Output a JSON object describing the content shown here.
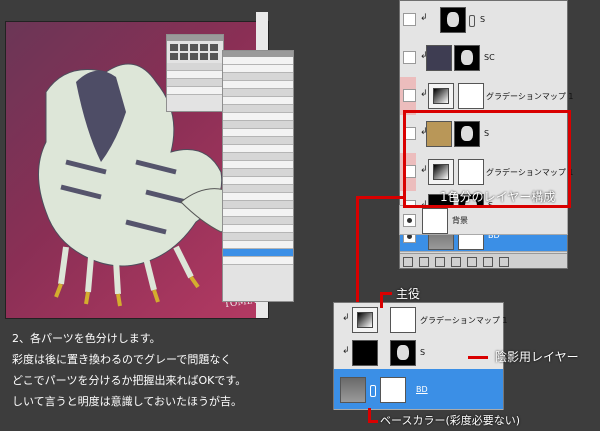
{
  "artist_signature": "TOMIA",
  "main_panel": {
    "layers": [
      {
        "label": "S",
        "thumb": "figure",
        "clipped": true,
        "highlight": false
      },
      {
        "label": "SC",
        "thumb": "navy",
        "clipped": true,
        "highlight": false
      },
      {
        "label": "グラデーションマップ 1",
        "thumb": "adj",
        "clipped": true,
        "highlight": true
      },
      {
        "label": "S",
        "thumb": "figure",
        "clipped": true,
        "highlight": false
      },
      {
        "label": "グラデーションマップ 1",
        "thumb": "adj",
        "clipped": true,
        "highlight": true
      },
      {
        "label": "S",
        "thumb": "figure",
        "clipped": true,
        "highlight": false
      },
      {
        "label": "BD",
        "thumb": "grey",
        "clipped": false,
        "highlight": false,
        "selected": true
      },
      {
        "label": "背景",
        "thumb": "white",
        "clipped": false,
        "highlight": false
      }
    ],
    "group_label": "1色分のレイヤー構成",
    "footer_icons": [
      "link-icon",
      "fx-icon",
      "mask-icon",
      "adjust-icon",
      "folder-icon",
      "new-layer-icon",
      "trash-icon"
    ]
  },
  "inset": {
    "rows": [
      {
        "label": "グラデーションマップ 1"
      },
      {
        "label": "S"
      },
      {
        "label": "BD"
      }
    ]
  },
  "annotations": {
    "main": "主役",
    "shadow": "陰影用レイヤー",
    "base": "ベースカラー(彩度必要ない)"
  },
  "caption": [
    "2、各パーツを色分けします。",
    "彩度は後に置き換わるのでグレーで問題なく",
    "どこでパーツを分けるか把握出来ればOKです。",
    "しいて言うと明度は意識しておいたほうが吉。"
  ],
  "colors": {
    "highlight": "#d90000",
    "selection": "#3b8fe6",
    "canvas_bg": "#8a2f55"
  }
}
